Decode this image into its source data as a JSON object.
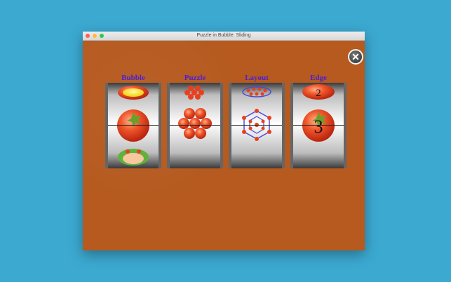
{
  "window": {
    "title": "Puzzle in Bubble: Sliding"
  },
  "close_button": {
    "symbol": "✕"
  },
  "reels": [
    {
      "label": "Bubble"
    },
    {
      "label": "Puzzle"
    },
    {
      "label": "Layout"
    },
    {
      "label": "Edge",
      "top_value": "2",
      "center_value": "3"
    }
  ],
  "colors": {
    "desktop": "#3ca9d1",
    "wood": "#b65a1f",
    "reel_label": "#4a1fd6",
    "tomato": "#e8401f"
  }
}
